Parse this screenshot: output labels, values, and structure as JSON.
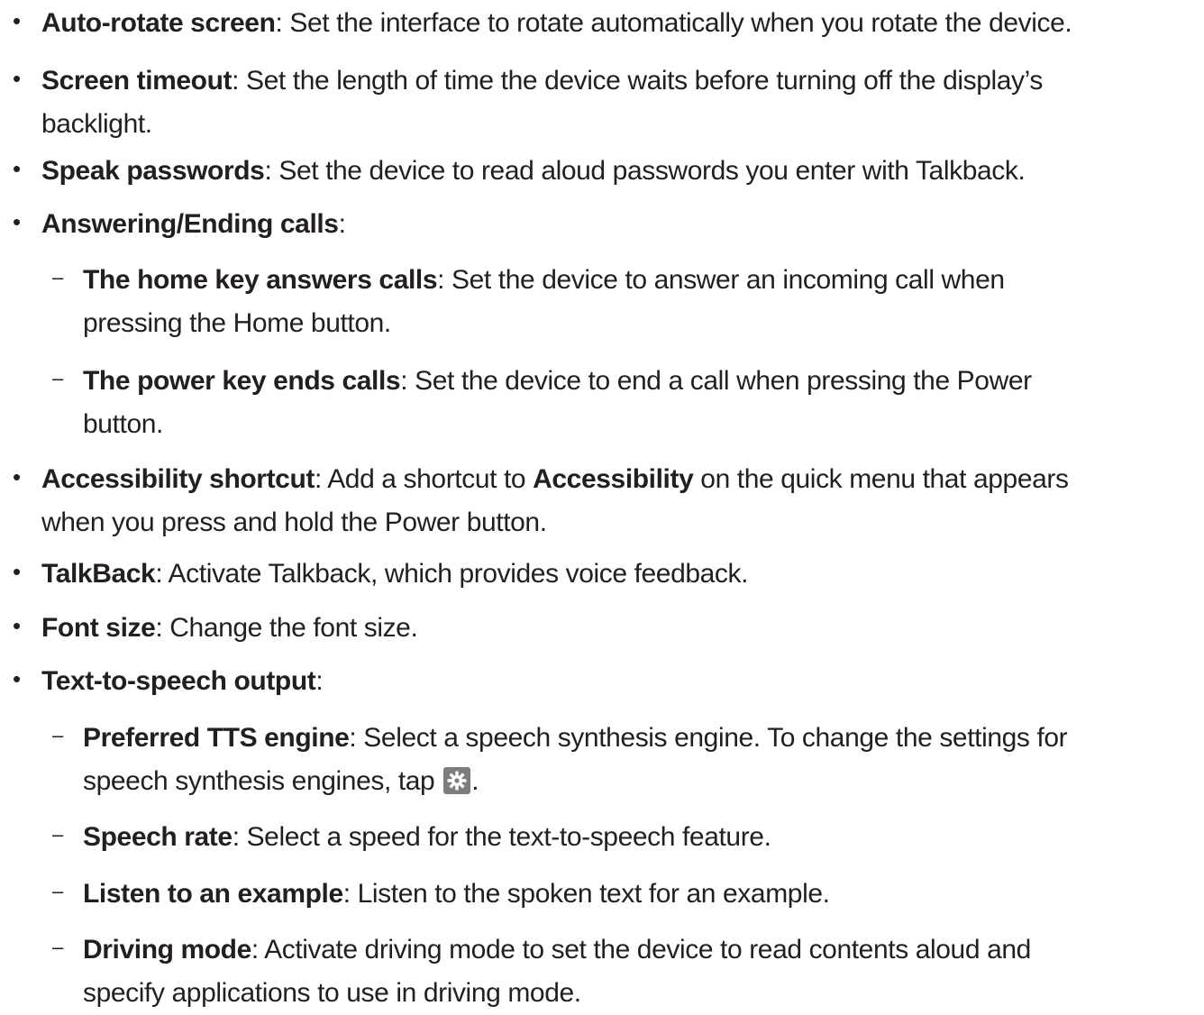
{
  "items": [
    {
      "marker": "•",
      "term": "Auto-rotate screen",
      "sep": ": ",
      "line1": "Set the interface to rotate automatically when you rotate the device.",
      "line2": ""
    },
    {
      "marker": "•",
      "term": "Screen timeout",
      "sep": ": ",
      "line1": "Set the length of time the device waits before turning off the display’s",
      "line2": "backlight."
    },
    {
      "marker": "•",
      "term": "Speak passwords",
      "sep": ": ",
      "line1": "Set the device to read aloud passwords you enter with Talkback.",
      "line2": ""
    },
    {
      "marker": "•",
      "term": "Answering/Ending calls",
      "sep": ":",
      "line1": "",
      "line2": ""
    },
    {
      "marker": "–",
      "term": "The home key answers calls",
      "sep": ": ",
      "line1": "Set the device to answer an incoming call when",
      "line2": "pressing the Home button."
    },
    {
      "marker": "–",
      "term": "The power key ends calls",
      "sep": ": ",
      "line1": "Set the device to end a call when pressing the Power",
      "line2": "button."
    },
    {
      "marker": "•",
      "term": "Accessibility shortcut",
      "sep": ": ",
      "line1_pre": "Add a shortcut to ",
      "line1_bold": "Accessibility",
      "line1_post": " on the quick menu that appears",
      "line2": "when you press and hold the Power button."
    },
    {
      "marker": "•",
      "term": "TalkBack",
      "sep": ": ",
      "line1": "Activate Talkback, which provides voice feedback.",
      "line2": ""
    },
    {
      "marker": "•",
      "term": "Font size",
      "sep": ": ",
      "line1": "Change the font size.",
      "line2": ""
    },
    {
      "marker": "•",
      "term": "Text-to-speech output",
      "sep": ":",
      "line1": "",
      "line2": ""
    },
    {
      "marker": "–",
      "term": "Preferred TTS engine",
      "sep": ": ",
      "line1": "Select a speech synthesis engine. To change the settings for",
      "line2": "speech synthesis engines, tap",
      "line2_end": ".",
      "icon": "settings-gear-icon"
    },
    {
      "marker": "–",
      "term": "Speech rate",
      "sep": ": ",
      "line1": "Select a speed for the text-to-speech feature.",
      "line2": ""
    },
    {
      "marker": "–",
      "term": "Listen to an example",
      "sep": ": ",
      "line1": "Listen to the spoken text for an example.",
      "line2": ""
    },
    {
      "marker": "–",
      "term": "Driving mode",
      "sep": ": ",
      "line1": "Activate driving mode to set the device to read contents aloud and",
      "line2": "specify applications to use in driving mode."
    }
  ]
}
